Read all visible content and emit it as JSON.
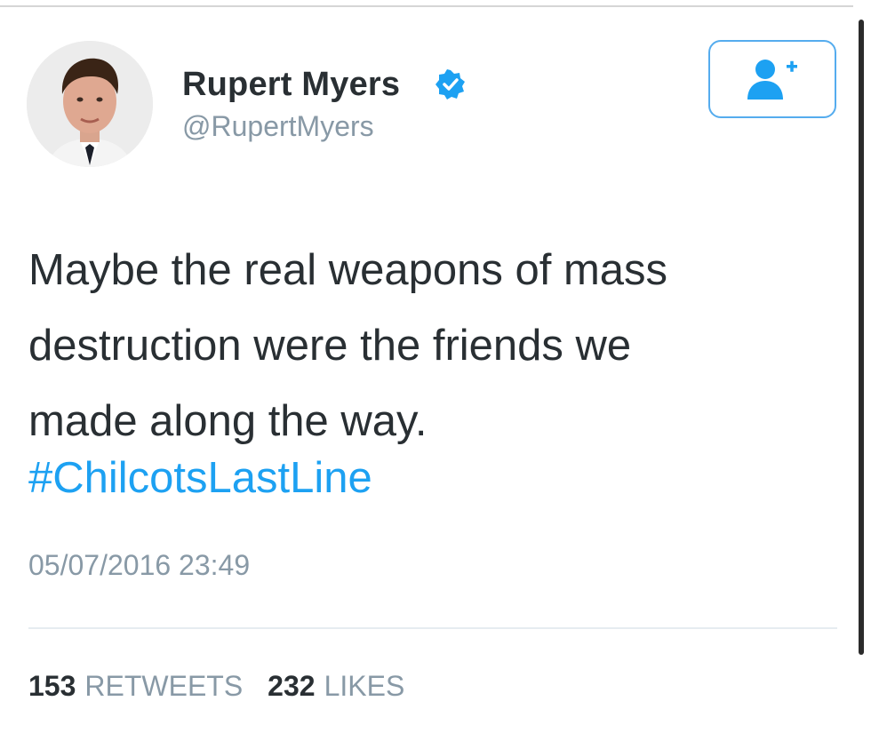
{
  "author": {
    "name": "Rupert Myers",
    "handle": "@RupertMyers",
    "verified_icon": "verified-badge-icon"
  },
  "follow_button": {
    "icon": "follow-user-plus-icon"
  },
  "tweet": {
    "text": "Maybe the real weapons of mass\ndestruction were the friends we\nmade along the way.",
    "hashtag": "#ChilcotsLastLine",
    "timestamp": "05/07/2016 23:49"
  },
  "stats": {
    "retweets_count": "153",
    "retweets_label": "RETWEETS",
    "likes_count": "232",
    "likes_label": "LIKES"
  },
  "colors": {
    "accent": "#1da1f2",
    "muted": "#8899a6",
    "text": "#292f33"
  }
}
